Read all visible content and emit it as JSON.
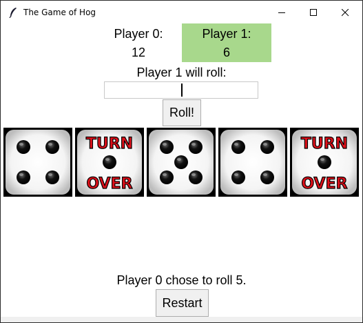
{
  "window": {
    "title": "The Game of Hog",
    "controls": [
      "minimize-icon",
      "maximize-icon",
      "close-icon"
    ]
  },
  "scores": {
    "player0": {
      "label": "Player 0:",
      "value": "12"
    },
    "player1": {
      "label": "Player 1:",
      "value": "6"
    },
    "active_player": 1,
    "active_color": "#a8d88c"
  },
  "roll_prompt": "Player 1 will roll:",
  "roll_input": {
    "value": ""
  },
  "buttons": {
    "roll": "Roll!",
    "restart": "Restart"
  },
  "dice": [
    {
      "face": 4
    },
    {
      "face": 1,
      "text_top": "TURN",
      "text_bottom": "OVER"
    },
    {
      "face": 5
    },
    {
      "face": 4
    },
    {
      "face": 1,
      "text_top": "TURN",
      "text_bottom": "OVER"
    }
  ],
  "status": "Player 0 chose to roll 5.",
  "colors": {
    "turn_over_text": "#e0101a",
    "pip": "#111111"
  }
}
